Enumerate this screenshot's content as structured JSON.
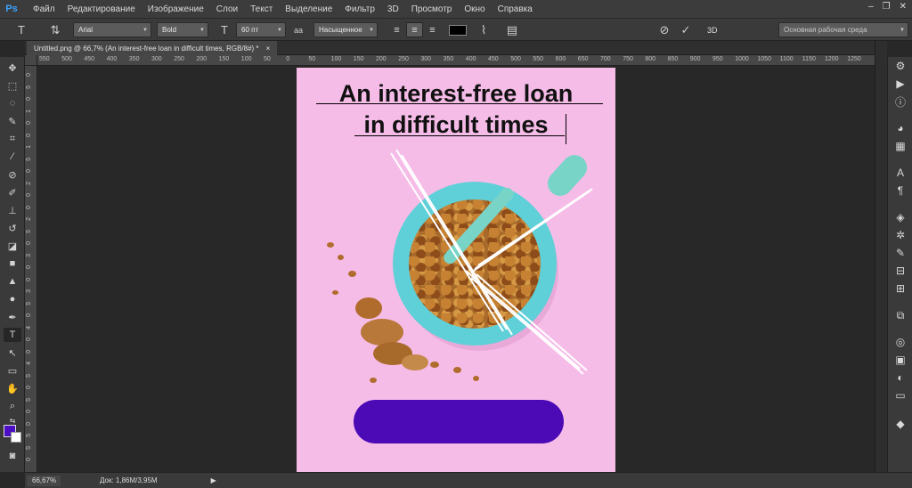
{
  "app": {
    "logo": "Ps",
    "menu": [
      "Файл",
      "Редактирование",
      "Изображение",
      "Слои",
      "Текст",
      "Выделение",
      "Фильтр",
      "3D",
      "Просмотр",
      "Окно",
      "Справка"
    ],
    "window_controls": [
      "–",
      "❐",
      "✕"
    ]
  },
  "options": {
    "font_family": "Arial",
    "font_style": "Bold",
    "font_size": "60 пт",
    "aa_label": "aa",
    "antialias": "Насыщенное",
    "text_color": "#000000",
    "workspace": "Основная рабочая среда",
    "label_3d": "3D"
  },
  "document": {
    "tab_title": "Untitled.png @ 66,7% (An interest-free loan  in difficult times, RGB/8#) *",
    "tab_close": "×"
  },
  "rulers": {
    "h_ticks": [
      "550",
      "500",
      "450",
      "400",
      "350",
      "300",
      "250",
      "200",
      "150",
      "100",
      "50",
      "0",
      "50",
      "100",
      "150",
      "200",
      "250",
      "300",
      "350",
      "400",
      "450",
      "500",
      "550",
      "600",
      "650",
      "700",
      "750",
      "800",
      "850",
      "900",
      "950",
      "1000",
      "1050",
      "1100",
      "1150",
      "1200",
      "1250"
    ],
    "v_ticks": [
      "0",
      "5",
      "0",
      "1",
      "0",
      "0",
      "1",
      "5",
      "0",
      "2",
      "0",
      "0",
      "2",
      "5",
      "0",
      "3",
      "0",
      "0",
      "3",
      "5",
      "0",
      "4",
      "0",
      "0",
      "4",
      "5",
      "0",
      "5",
      "0",
      "0",
      "5",
      "5",
      "0"
    ]
  },
  "canvas": {
    "headline_line1": "An interest-free loan",
    "headline_line2": "in difficult times",
    "background": "#f6bce8",
    "button_color": "#4c0ab6"
  },
  "colors": {
    "foreground": "#4b0ec2",
    "background": "#ffffff"
  },
  "status": {
    "zoom": "66,67%",
    "doc_size": "Док: 1,86M/3,95M",
    "arrow": "▶"
  }
}
